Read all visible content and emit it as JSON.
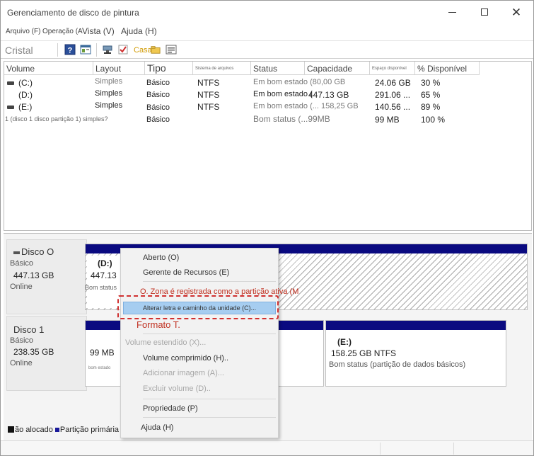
{
  "window": {
    "title": "Gerenciamento de disco de pintura",
    "controls": {
      "minimize": "",
      "maximize": "",
      "close": "✕"
    }
  },
  "menubar": {
    "items": [
      "Arquivo (F)",
      "Operação (A",
      "Vista (V)",
      "Ajuda (H)"
    ]
  },
  "toolbar": {
    "label": "Cristal",
    "casa_label": "Casa",
    "icons": [
      "help-icon",
      "console-icon",
      "connect-icon",
      "check-icon",
      "folder-icon",
      "properties-icon"
    ]
  },
  "volumes": {
    "columns": [
      "Volume",
      "Layout",
      "Tipo",
      "Sistema de arquivos",
      "Status",
      "Capacidade",
      "Espaço disponível",
      "% Disponível"
    ],
    "rows": [
      {
        "volume": "(C:)",
        "layout": "Simples",
        "type": "Básico",
        "fs": "NTFS",
        "status": "Em bom estado (80,00 GB",
        "capacity": "24.06 GB",
        "pct": "30 %"
      },
      {
        "volume": "(D:)",
        "layout": "Simples",
        "type": "Básico",
        "fs": "NTFS",
        "status": "Em bom estado (",
        "capacity_overlap": "447.13 GB",
        "capacity": "291.06 ...",
        "pct": "65 %"
      },
      {
        "volume": "(E:)",
        "layout": "Simples",
        "type": "Básico",
        "fs": "NTFS",
        "status": "Em bom estado (... 158,25 GB",
        "capacity": "140.56 ...",
        "pct": "89 %"
      },
      {
        "volume": "1 (disco 1 disco partição 1) simples?",
        "layout": "",
        "type": "Básico",
        "fs": "",
        "status": "Bom status (...99MB",
        "capacity": "99 MB",
        "pct": "100 %"
      }
    ]
  },
  "disks": [
    {
      "name": "Disco O",
      "type": "Básico",
      "size": "447.13 GB",
      "state": "Online",
      "partition": {
        "label": "(D:)",
        "size": "447.13",
        "status": "Bom status"
      }
    },
    {
      "name": "Disco 1",
      "type": "Básico",
      "size": "238.35 GB",
      "state": "Online",
      "partitions": [
        {
          "size": "99 MB",
          "status": "bom estado"
        },
        {
          "label": "(E:)",
          "size": "158.25 GB NTFS",
          "status": "Bom status (partição de dados básicos)"
        }
      ]
    }
  ],
  "legend": {
    "unallocated": "ão alocado",
    "primary": "Partição primária"
  },
  "context_menu": {
    "open": "Aberto (O)",
    "explorer": "Gerente de Recursos (E)",
    "mark_active": "O. Zona é registrada como a partição ativa (M",
    "change_letter": "Alterar letra e caminho da unidade (C)...",
    "format": "Formato T.",
    "extend": "Volume estendido (X)...",
    "shrink": "Volume comprimido (H)..",
    "add_mirror": "Adicionar imagem (A)...",
    "delete": "Excluir volume (D)..",
    "properties": "Propriedade (P)",
    "help": "Ajuda (H)"
  },
  "colors": {
    "partition_header": "#0a0a80",
    "highlight": "#a6cdf0",
    "annotation": "#d03030"
  }
}
